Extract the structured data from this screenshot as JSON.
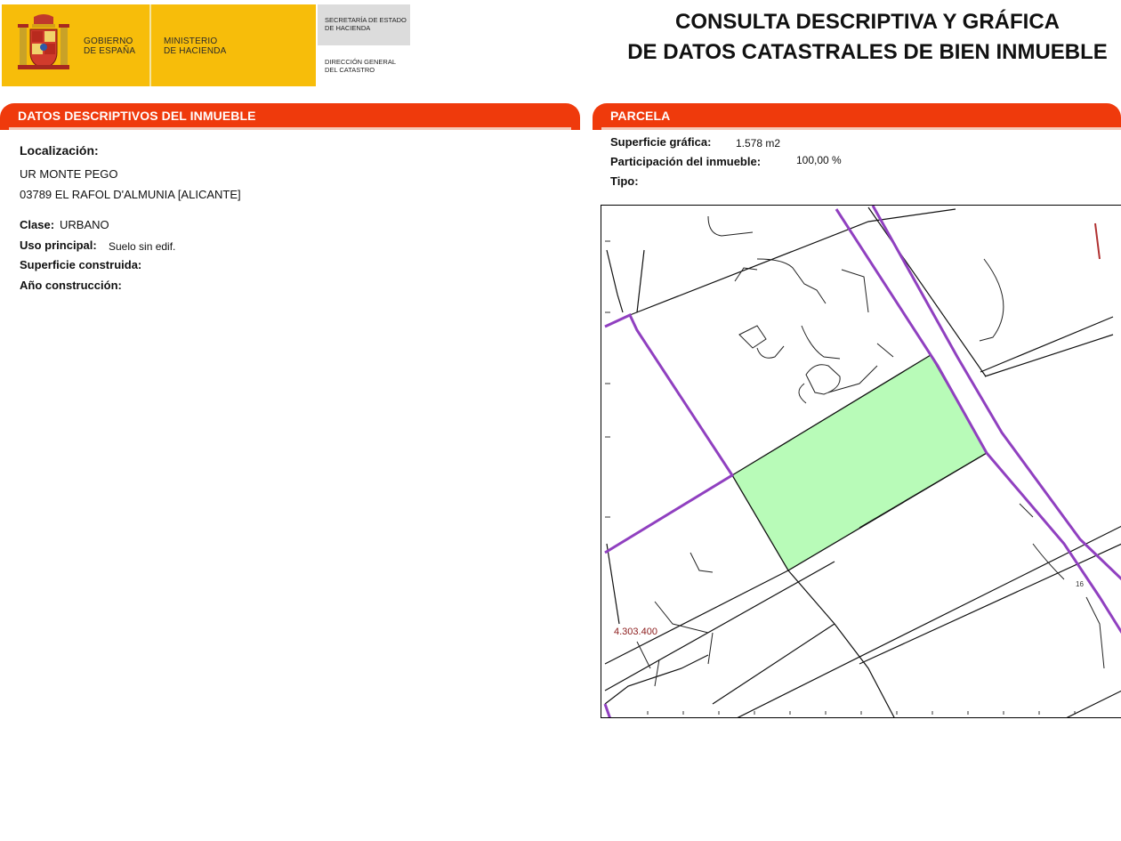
{
  "header": {
    "gobierno_line1": "GOBIERNO",
    "gobierno_line2": "DE ESPAÑA",
    "ministerio_line1": "MINISTERIO",
    "ministerio_line2": "DE HACIENDA",
    "secretaria_line1": "SECRETARÍA DE ESTADO",
    "secretaria_line2": "DE HACIENDA",
    "direccion_line1": "DIRECCIÓN GENERAL",
    "direccion_line2": "DEL CATASTRO",
    "title_line1": "CONSULTA DESCRIPTIVA Y GRÁFICA",
    "title_line2": "DE DATOS CATASTRALES DE BIEN INMUEBLE",
    "brand_yellow": "#f7bd0a",
    "band_color": "#ef3a0c"
  },
  "descriptivos": {
    "section_title": "DATOS DESCRIPTIVOS DEL INMUEBLE",
    "localizacion_label": "Localización:",
    "address_line1": "UR MONTE PEGO",
    "address_line2": "03789 EL RAFOL D'ALMUNIA [ALICANTE]",
    "clase_label": "Clase:",
    "clase_value": "URBANO",
    "uso_label": "Uso principal:",
    "uso_value": "Suelo sin edif.",
    "superficie_label": "Superficie construida:",
    "anio_label": "Año construcción:"
  },
  "parcela": {
    "section_title": "PARCELA",
    "superficie_label": "Superficie gráfica:",
    "superficie_value": "1.578 m2",
    "participacion_label": "Participación del inmueble:",
    "participacion_value": "100,00 %",
    "tipo_label": "Tipo:",
    "map_coordinate": "4.303.400",
    "map_house_number": "16",
    "parcel_fill": "#b8fbb8",
    "boundary_color": "#9040c0"
  }
}
